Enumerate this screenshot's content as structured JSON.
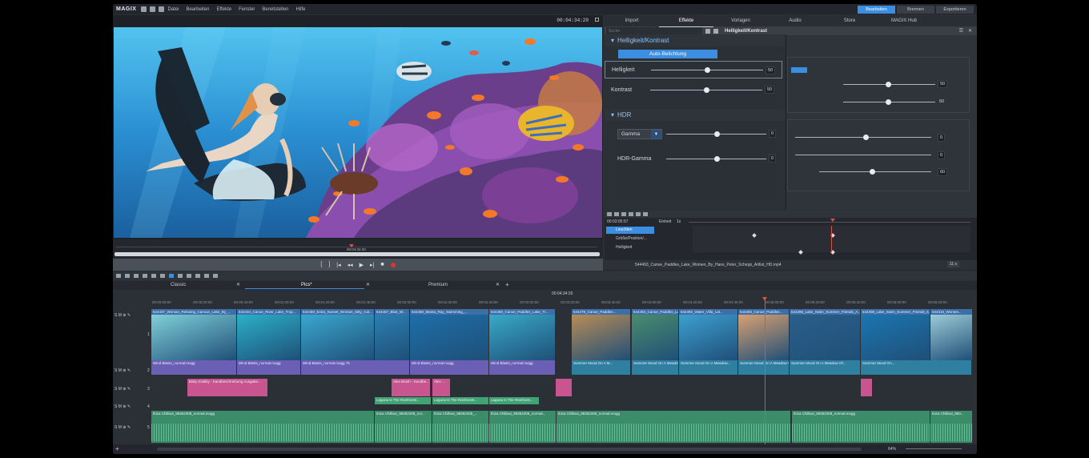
{
  "app": {
    "logo": "MAGIX",
    "menu": [
      "Datei",
      "Bearbeiten",
      "Effekte",
      "Fenster",
      "Bereitstellen",
      "Hilfe"
    ],
    "modes": [
      "Bearbeiten",
      "Brennen",
      "Exportieren"
    ],
    "active_mode": "Bearbeiten"
  },
  "preview": {
    "timecode": "00:04:34:20",
    "scrub_time": "00:04:34:20"
  },
  "panel": {
    "tabs": [
      "Import",
      "Effekte",
      "Vorlagen",
      "Audio",
      "Store",
      "MAGIX Hub"
    ],
    "active_tab": "Effekte",
    "search_placeholder": "Suche",
    "effect_title": "Helligkeit/Kontrast",
    "section1": "Helligkeit/Kontrast",
    "auto_button": "Auto-Belichtung",
    "brightness_label": "Helligkeit",
    "brightness_value": "50",
    "contrast_label": "Kontrast",
    "contrast_value": "50",
    "section2": "HDR",
    "gamma_select": "Gamma",
    "gamma_value": "0",
    "hdr_gamma_label": "HDR-Gamma",
    "hdr_gamma_value": "0",
    "bg_values": [
      "50",
      "50",
      "0",
      "0",
      "60"
    ]
  },
  "keyframes": {
    "time": "00:03:05:57",
    "unit_label": "Einheit",
    "unit_value": "1s",
    "rows": [
      "Leuchten",
      "Größe/Position/...",
      "Helligkeit"
    ],
    "clip_name": "544493_Canoe_Paddles_Lake_Women_By_Hans_Peter_Schepp_Artlist_HD.mp4",
    "zoom": "11 s"
  },
  "timeline": {
    "tabs": [
      "Classic",
      "Pics*",
      "Premium"
    ],
    "current_time": "00:04:34:20",
    "ruler": [
      "00:00:00:00",
      "00:00:20:00",
      "00:00:40:00",
      "00:01:00:00",
      "00:01:20:00",
      "00:01:40:00",
      "00:02:00:00",
      "00:02:20:00",
      "00:02:40:00",
      "00:03:00:00",
      "00:03:20:00",
      "00:03:40:00",
      "00:04:00:00",
      "00:04:20:00",
      "00:04:40:00",
      "00:05:00:00",
      "00:05:20:00",
      "00:05:40:00",
      "00:06:00:00",
      "00:06:20:00"
    ],
    "video_clips": [
      "544437_Woman_Relaxing_Cancun_Lake_By_...",
      "544434_Canoe_River_Lake_Trop...",
      "544450_Extra_Sunset_Woman_Sitty_Cal...",
      "544457_Blue_W...",
      "544460_Manta_Ray_Swimming_...",
      "544460_Canoe_Paddles_Lake_Tr...",
      "544479_Canoe_Paddles...",
      "544493_Canoe_Paddles_Lak...",
      "544492_Water_Villa_Lat...",
      "544493_Canoe_Paddles...",
      "544296_Lake_Swim_Summer_Friends_A...",
      "544308_Lake_Swim_Summer_Friends_6...",
      "544310_Women..."
    ],
    "audio_clips_2": [
      "Wind Blasts_normal.mogg",
      "Wind Blasts_normal.mogg",
      "Wind Blasts_normal.mogg 75",
      "Wind Blasts_normal.mogg",
      "Wind Blasts_normal.mogg",
      "Summer Mood On A M...",
      "Summer Mood On A Meadow...",
      "Summer Mood On A Meadow...",
      "Summer Mood On A Meadow Of Flowers",
      "Summer Mood On A Meadow Of...",
      "Summer Mood On..."
    ],
    "track3_clips": [
      "Baby Krabby - Kandbeschreibung Ausgabe...",
      "Alex Brush - Kandbe...",
      "Alex ..."
    ],
    "track4_clips": [
      "Laguna Is The Rainforest...",
      "Laguna Is The Rainforest...",
      "Laguna Is The Rainfores..."
    ],
    "track5_clips": [
      "Ibiza Chillout_98362308_normal.mogg",
      "Ibiza Chillout_98362308_nor...",
      "Ibiza Chillout_98362308_...",
      "Ibiza Chillout_98362308_normal...",
      "Ibiza Chillout_98362308_normal.mogg",
      "Ibiza Chillout_98362308_normal.mogg",
      "Ibiza Chillout_983..."
    ],
    "track_nums": [
      "1",
      "2",
      "3",
      "4",
      "5"
    ],
    "zoom_pct": "64%"
  },
  "colors": {
    "accent": "#3b8ee0",
    "video_clip": "#3c6fa8",
    "audio_clip": "#6b5fb5",
    "title_clip": "#c8558f",
    "green_clip": "#3fa372",
    "music_clip": "#3b8d6a",
    "playhead": "#e05040"
  }
}
